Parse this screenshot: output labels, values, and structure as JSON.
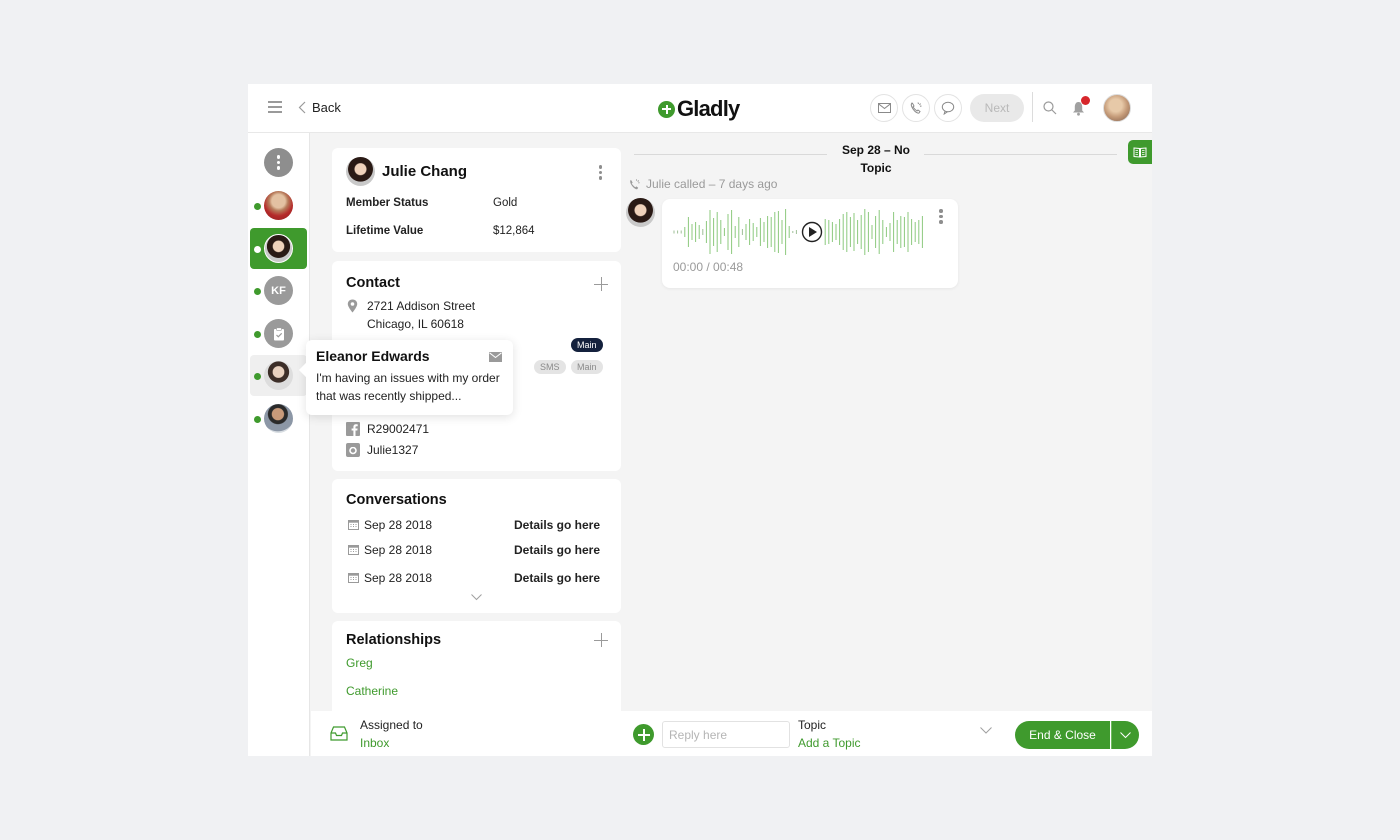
{
  "header": {
    "back_label": "Back",
    "logo_text": "Gladly",
    "next_label": "Next",
    "channel_buttons": [
      "email",
      "phone",
      "chat"
    ],
    "has_notification": true
  },
  "sidebar": {
    "items": [
      {
        "type": "more",
        "label": ""
      },
      {
        "type": "avatar",
        "label": "",
        "online": true
      },
      {
        "type": "avatar",
        "label": "",
        "online": true,
        "active": true
      },
      {
        "type": "initials",
        "label": "KF",
        "online": true
      },
      {
        "type": "task",
        "label": "",
        "online": true
      },
      {
        "type": "avatar",
        "label": "",
        "online": true,
        "hover": true
      },
      {
        "type": "avatar",
        "label": "",
        "online": true
      }
    ]
  },
  "tooltip": {
    "name": "Eleanor Edwards",
    "message": "I'm having an issues with my order that was recently shipped..."
  },
  "customer": {
    "name": "Julie Chang",
    "fields": [
      {
        "label": "Member Status",
        "value": "Gold"
      },
      {
        "label": "Lifetime Value",
        "value": "$12,864"
      }
    ]
  },
  "contact": {
    "title": "Contact",
    "address_line1": "2721 Addison Street",
    "address_line2": "Chicago, IL 60618",
    "email_badge": "Main",
    "phone_badges": [
      "SMS",
      "Main"
    ],
    "facebook": "R29002471",
    "instagram": "Julie1327"
  },
  "conversations": {
    "title": "Conversations",
    "rows": [
      {
        "date": "Sep 28 2018",
        "details": "Details go here"
      },
      {
        "date": "Sep 28 2018",
        "details": "Details go here"
      },
      {
        "date": "Sep 28 2018",
        "details": "Details go here"
      }
    ]
  },
  "relationships": {
    "title": "Relationships",
    "people": [
      "Greg",
      "Catherine"
    ]
  },
  "timeline": {
    "date_separator": "Sep 28 – No Topic",
    "call_meta": "Julie called – 7 days ago",
    "audio_time": "00:00 / 00:48",
    "audio_progress": 0
  },
  "bottom": {
    "assigned_label": "Assigned to",
    "assigned_value": "Inbox",
    "reply_placeholder": "Reply here",
    "topic_label": "Topic",
    "topic_value": "Add a Topic",
    "end_close_label": "End & Close"
  },
  "colors": {
    "brand_green": "#3f9a2d",
    "notification_red": "#d7262b",
    "badge_dark": "#14213d"
  }
}
